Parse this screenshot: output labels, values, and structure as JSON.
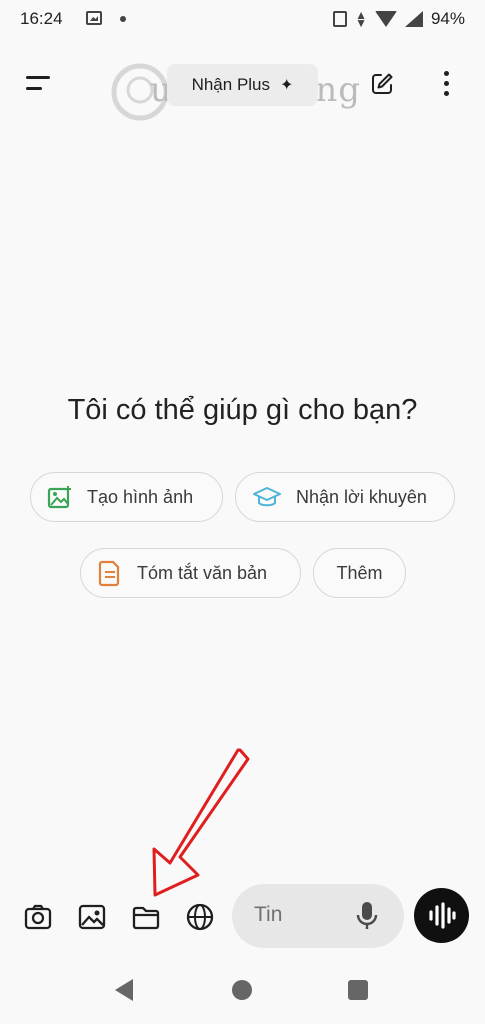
{
  "status_bar": {
    "time": "16:24",
    "battery": "94%",
    "icons": [
      "gallery-icon",
      "dot-icon",
      "vibrate-icon",
      "data-arrows-icon",
      "wifi-icon",
      "signal-icon"
    ]
  },
  "header": {
    "menu_icon": "menu-icon",
    "plus_label": "Nhận Plus",
    "plus_icon": "sparkle-icon",
    "edit_icon": "edit-icon",
    "more_icon": "more-vertical-icon",
    "watermark_text": "uantrimang"
  },
  "main": {
    "headline": "Tôi có thể giúp gì cho bạn?",
    "chips": [
      {
        "label": "Tạo hình ảnh",
        "icon": "image-create-icon",
        "color": "#3aa655"
      },
      {
        "label": "Nhận lời khuyên",
        "icon": "graduation-cap-icon",
        "color": "#4fb5d6"
      },
      {
        "label": "Tóm tắt văn bản",
        "icon": "document-icon",
        "color": "#e0823b"
      },
      {
        "label": "Thêm",
        "icon": "",
        "color": ""
      }
    ]
  },
  "composer": {
    "tools": [
      "camera-icon",
      "photo-icon",
      "folder-icon",
      "globe-icon"
    ],
    "placeholder": "Tin",
    "mic_icon": "microphone-icon",
    "voice_icon": "voice-mode-icon"
  },
  "annotation": {
    "arrow_color": "#e01e1e"
  },
  "nav": [
    "back-icon",
    "home-icon",
    "recents-icon"
  ]
}
